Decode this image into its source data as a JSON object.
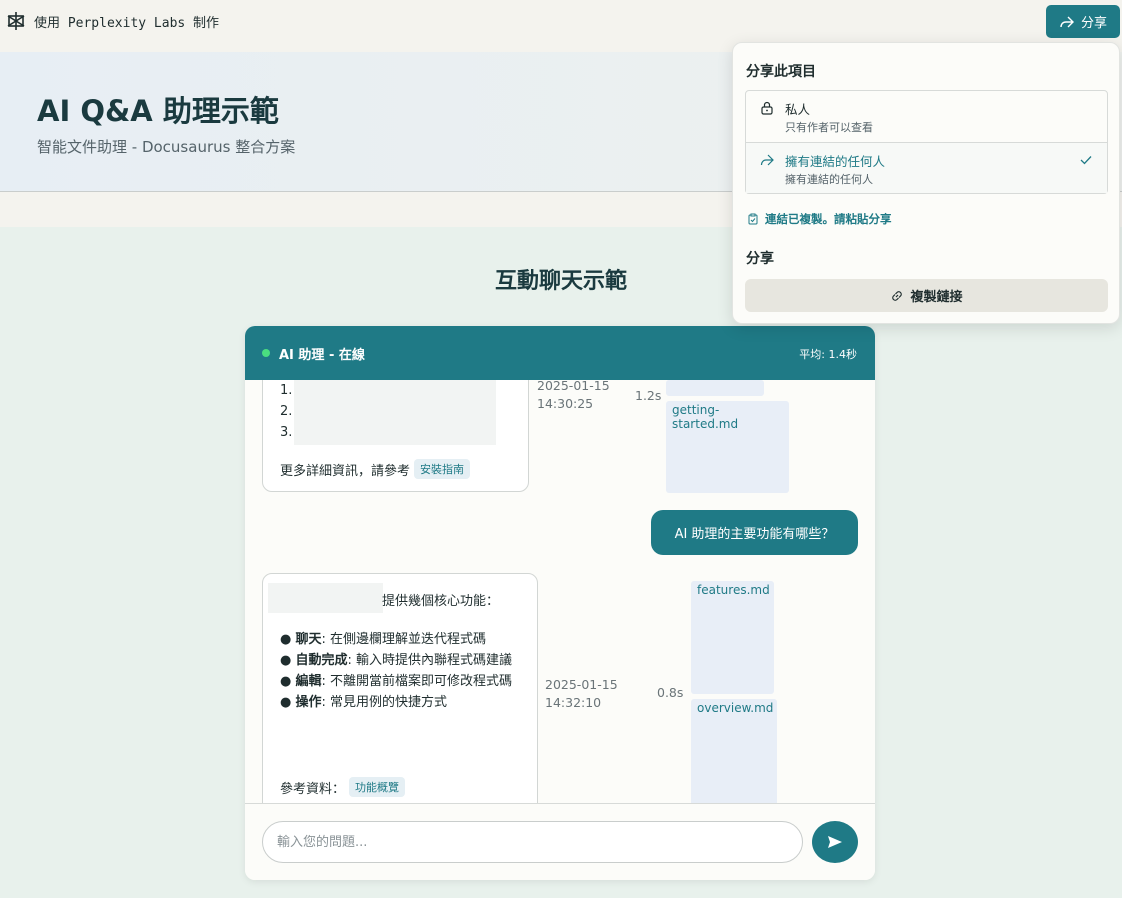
{
  "topbar": {
    "brand_label": "使用 Perplexity Labs 制作",
    "brand_icon": "perplexity-logo-icon",
    "share_label": "分享"
  },
  "hero": {
    "title": "AI Q&A 助理示範",
    "subtitle": "智能文件助理 - Docusaurus 整合方案"
  },
  "section": {
    "title": "互動聊天示範"
  },
  "chat": {
    "title": "AI 助理 - 在線",
    "avg": "平均: 1.4秒",
    "messages": [
      {
        "list": [
          "1.",
          "2.",
          "3."
        ],
        "more": "更多詳細資訊，請參考",
        "ref": "安裝指南",
        "time": "2025-01-15\n14:30:25",
        "time_date": "2025-01-15",
        "time_clock": "14:30:25",
        "duration": "1.2s",
        "source": "getting-started.md"
      },
      {
        "user": "AI 助理的主要功能有哪些？"
      },
      {
        "intro": "提供幾個核心功能：",
        "features": [
          {
            "name": "聊天",
            "desc": ": 在側邊欄理解並迭代程式碼"
          },
          {
            "name": "自動完成",
            "desc": ": 輸入時提供內聯程式碼建議"
          },
          {
            "name": "編輯",
            "desc": ": 不離開當前檔案即可修改程式碼"
          },
          {
            "name": "操作",
            "desc": ": 常見用例的快捷方式"
          }
        ],
        "ref_label": "參考資料：",
        "ref": "功能概覽",
        "time_date": "2025-01-15",
        "time_clock": "14:32:10",
        "duration": "0.8s",
        "sources": [
          "features.md",
          "overview.md"
        ]
      }
    ],
    "input_placeholder": "輸入您的問題..."
  },
  "share_popover": {
    "title": "分享此項目",
    "options": [
      {
        "label": "私人",
        "desc": "只有作者可以查看"
      },
      {
        "label": "擁有連結的任何人",
        "desc": "擁有連結的任何人"
      }
    ],
    "copied_note": "連結已複製。請粘貼分享",
    "share_heading": "分享",
    "copy_button": "複製鏈接"
  },
  "colors": {
    "accent": "#1f7a86",
    "online": "#4ade80",
    "source_bg": "#e8eef7"
  }
}
